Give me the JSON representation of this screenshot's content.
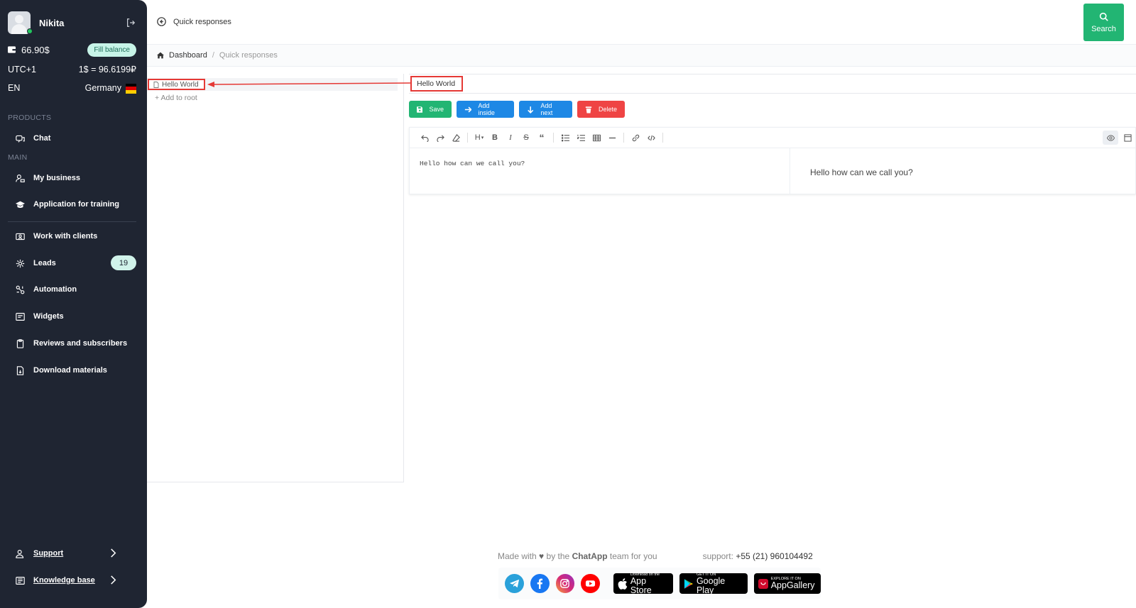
{
  "user": {
    "name": "Nikita"
  },
  "balance": {
    "amount": "66.90$",
    "fill_label": "Fill balance"
  },
  "timezone": {
    "label": "UTC+1",
    "rate": "1$ = 96.6199₽"
  },
  "locale": {
    "lang": "EN",
    "country": "Germany"
  },
  "sections": {
    "products": "PRODUCTS",
    "main": "MAIN"
  },
  "nav": {
    "chat": "Chat",
    "my_business": "My business",
    "training": "Application for training",
    "work_clients": "Work with clients",
    "leads": "Leads",
    "leads_count": "19",
    "automation": "Automation",
    "widgets": "Widgets",
    "reviews": "Reviews and subscribers",
    "download": "Download materials",
    "support": "Support",
    "knowledge": "Knowledge base"
  },
  "header": {
    "title": "Quick responses",
    "search_label": "Search"
  },
  "breadcrumb": {
    "home": "Dashboard",
    "current": "Quick responses"
  },
  "tree": {
    "node_label": "Hello World",
    "add_root": "+ Add to root"
  },
  "editor": {
    "title_value": "Hello World",
    "buttons": {
      "save": "Save",
      "add_inside": "Add inside",
      "add_next": "Add next",
      "delete": "Delete"
    },
    "source_text": "Hello how can we call you?",
    "preview_text": "Hello how can we call you?",
    "toolbar_heading": "H",
    "toolbar_bold": "B",
    "toolbar_italic": "I",
    "toolbar_strike": "S",
    "toolbar_quote": "“"
  },
  "footer": {
    "made_with": "Made with",
    "by_the": "by the",
    "brand": "ChatApp",
    "team": "team for you",
    "support_label": "support:",
    "phone": "+55 (21) 960104492",
    "stores": {
      "appstore_small": "Download on the",
      "appstore_big": "App Store",
      "google_small": "GET IT ON",
      "google_big": "Google Play",
      "huawei_small": "EXPLORE IT ON",
      "huawei_big": "AppGallery"
    }
  },
  "colors": {
    "sidebar": "#1f2532",
    "green": "#22b573",
    "blue": "#1e88e5",
    "red": "#ef4444",
    "highlight": "#e53935"
  }
}
